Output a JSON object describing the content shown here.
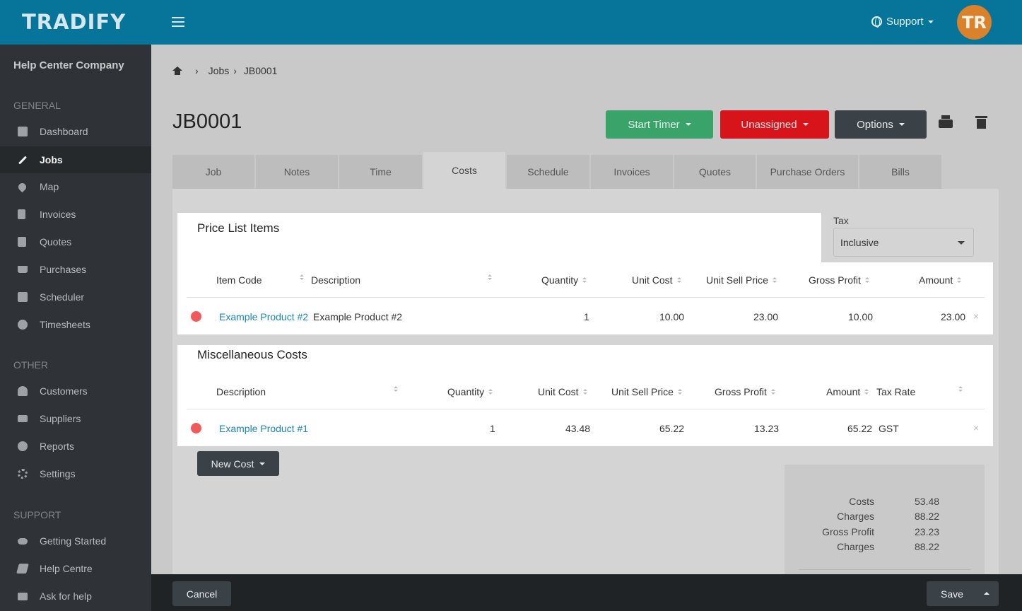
{
  "app": {
    "logo": "TRADIFY",
    "support_label": "Support",
    "avatar_initials": "TR",
    "brand_color": "#07749a"
  },
  "sidebar": {
    "company": "Help Center Company",
    "sections": {
      "general": "GENERAL",
      "other": "OTHER",
      "support": "SUPPORT"
    },
    "general_items": [
      {
        "label": "Dashboard",
        "icon": "dashboard-icon"
      },
      {
        "label": "Jobs",
        "icon": "wrench-icon",
        "active": true
      },
      {
        "label": "Map",
        "icon": "map-pin-icon"
      },
      {
        "label": "Invoices",
        "icon": "invoice-icon"
      },
      {
        "label": "Quotes",
        "icon": "calculator-icon"
      },
      {
        "label": "Purchases",
        "icon": "cart-icon"
      },
      {
        "label": "Scheduler",
        "icon": "calendar-icon"
      },
      {
        "label": "Timesheets",
        "icon": "clock-icon"
      }
    ],
    "other_items": [
      {
        "label": "Customers",
        "icon": "users-icon"
      },
      {
        "label": "Suppliers",
        "icon": "truck-icon"
      },
      {
        "label": "Reports",
        "icon": "pie-chart-icon"
      },
      {
        "label": "Settings",
        "icon": "gear-icon"
      }
    ],
    "support_items": [
      {
        "label": "Getting Started",
        "icon": "hand-point-icon"
      },
      {
        "label": "Help Centre",
        "icon": "book-icon"
      },
      {
        "label": "Ask for help",
        "icon": "chat-icon"
      }
    ]
  },
  "breadcrumb": {
    "jobs": "Jobs",
    "current": "JB0001"
  },
  "page": {
    "title": "JB0001"
  },
  "actions": {
    "start_timer": "Start Timer",
    "assignee": "Unassigned",
    "options": "Options"
  },
  "tabs": [
    "Job",
    "Notes",
    "Time",
    "Costs",
    "Schedule",
    "Invoices",
    "Quotes",
    "Purchase Orders",
    "Bills"
  ],
  "active_tab": "Costs",
  "tax": {
    "label": "Tax",
    "selected": "Inclusive"
  },
  "price_list": {
    "title": "Price List Items",
    "headers": {
      "item_code": "Item Code",
      "description": "Description",
      "quantity": "Quantity",
      "unit_cost": "Unit Cost",
      "unit_sell_price": "Unit Sell Price",
      "gross_profit": "Gross Profit",
      "amount": "Amount"
    },
    "rows": [
      {
        "item_code": "Example Product #2",
        "description": "Example Product #2",
        "quantity": "1",
        "unit_cost": "10.00",
        "unit_sell_price": "23.00",
        "gross_profit": "10.00",
        "amount": "23.00"
      }
    ]
  },
  "misc_costs": {
    "title": "Miscellaneous Costs",
    "headers": {
      "description": "Description",
      "quantity": "Quantity",
      "unit_cost": "Unit Cost",
      "unit_sell_price": "Unit Sell Price",
      "gross_profit": "Gross Profit",
      "amount": "Amount",
      "tax_rate": "Tax Rate"
    },
    "rows": [
      {
        "description": "Example Product #1",
        "quantity": "1",
        "unit_cost": "43.48",
        "unit_sell_price": "65.22",
        "gross_profit": "13.23",
        "amount": "65.22",
        "tax_rate": "GST"
      }
    ]
  },
  "new_cost_label": "New Cost",
  "summary": [
    {
      "label": "Costs",
      "value": "53.48"
    },
    {
      "label": "Charges",
      "value": "88.22"
    },
    {
      "label": "Gross Profit",
      "value": "23.23"
    },
    {
      "label": "Charges",
      "value": "88.22"
    }
  ],
  "footer": {
    "cancel": "Cancel",
    "save": "Save"
  },
  "remove_glyph": "×"
}
